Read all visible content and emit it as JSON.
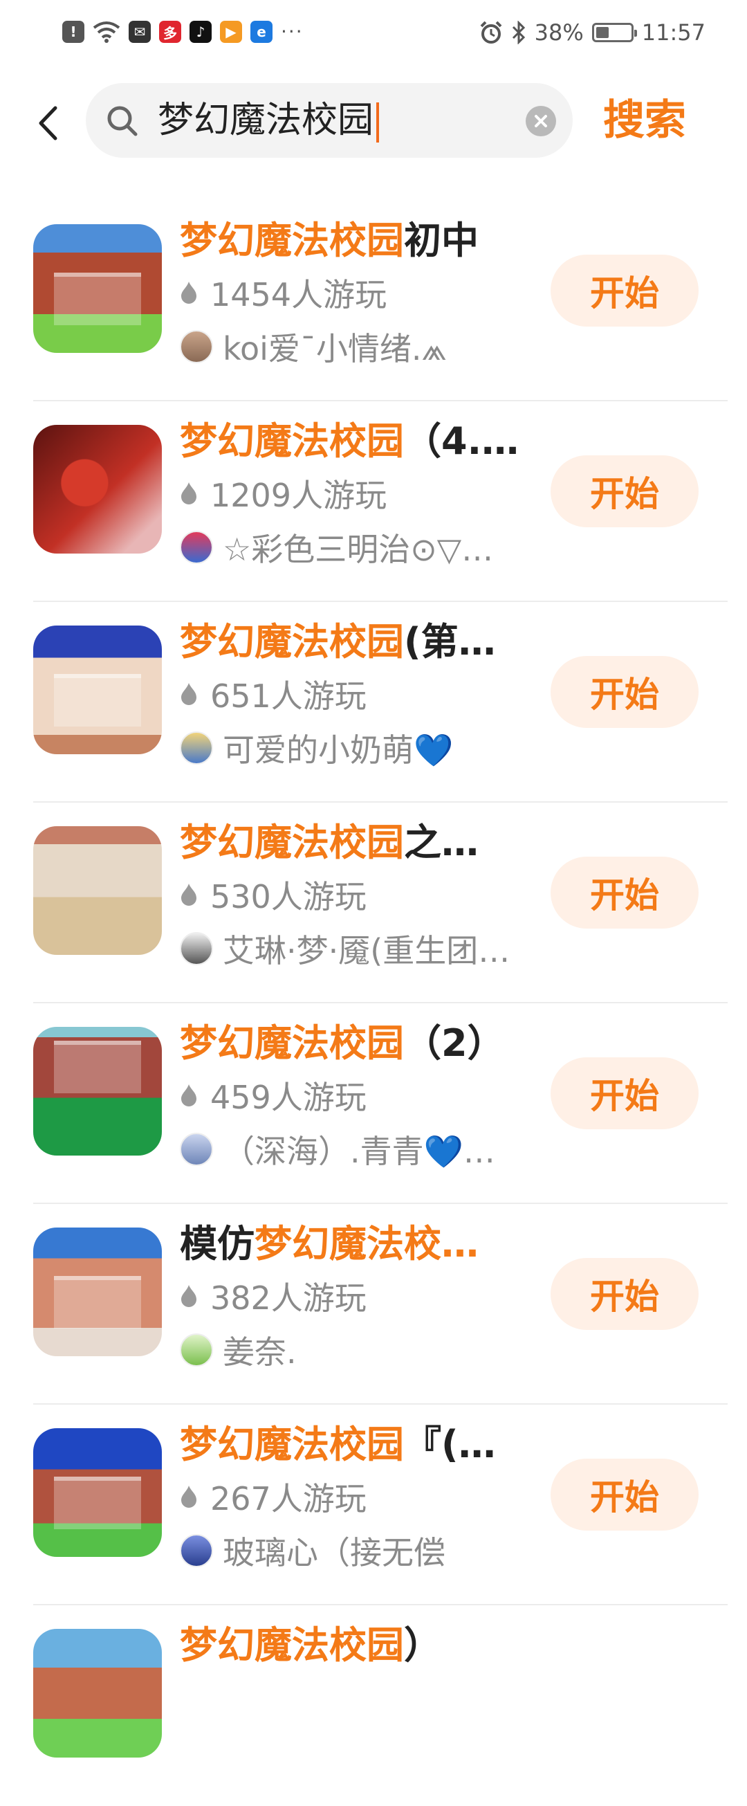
{
  "status_bar": {
    "battery": "38%",
    "battery_level": 0.38,
    "time": "11:57",
    "more": "···"
  },
  "search": {
    "query": "梦幻魔法校园",
    "button_label": "搜索"
  },
  "results": [
    {
      "highlight": "梦幻魔法校园",
      "prefix": "",
      "suffix": "初中",
      "plays": "1454人游玩",
      "author": "koi爱¯小情绪.⩕",
      "button": "开始"
    },
    {
      "highlight": "梦幻魔法校园",
      "prefix": "",
      "suffix": "（4.…",
      "plays": "1209人游玩",
      "author": "☆彩色三明治⊙▽…",
      "button": "开始"
    },
    {
      "highlight": "梦幻魔法校园",
      "prefix": "",
      "suffix": "(第…",
      "plays": "651人游玩",
      "author": "可爱的小奶萌💙",
      "button": "开始"
    },
    {
      "highlight": "梦幻魔法校园",
      "prefix": "",
      "suffix": "之…",
      "plays": "530人游玩",
      "author": "艾琳·梦·魇(重生团…",
      "button": "开始"
    },
    {
      "highlight": "梦幻魔法校园",
      "prefix": "",
      "suffix": "（2）",
      "plays": "459人游玩",
      "author": "（深海）.青青💙…",
      "button": "开始"
    },
    {
      "highlight": "梦幻魔法校…",
      "prefix": "模仿",
      "suffix": "",
      "plays": "382人游玩",
      "author": "姜奈.",
      "button": "开始"
    },
    {
      "highlight": "梦幻魔法校园",
      "prefix": "",
      "suffix": "『(…",
      "plays": "267人游玩",
      "author": "玻璃心（接无偿",
      "button": "开始"
    },
    {
      "highlight": "梦幻魔法校园",
      "prefix": "",
      "suffix": "）",
      "plays": "",
      "author": "",
      "button": ""
    }
  ],
  "colors": {
    "accent": "#f47a17",
    "button_bg": "#fff0e6",
    "text_secondary": "#8a8a8a"
  },
  "icons": [
    "back-arrow-icon",
    "search-icon",
    "clear-icon",
    "flame-icon",
    "alarm-icon",
    "bluetooth-icon",
    "battery-icon",
    "wifi-icon"
  ]
}
